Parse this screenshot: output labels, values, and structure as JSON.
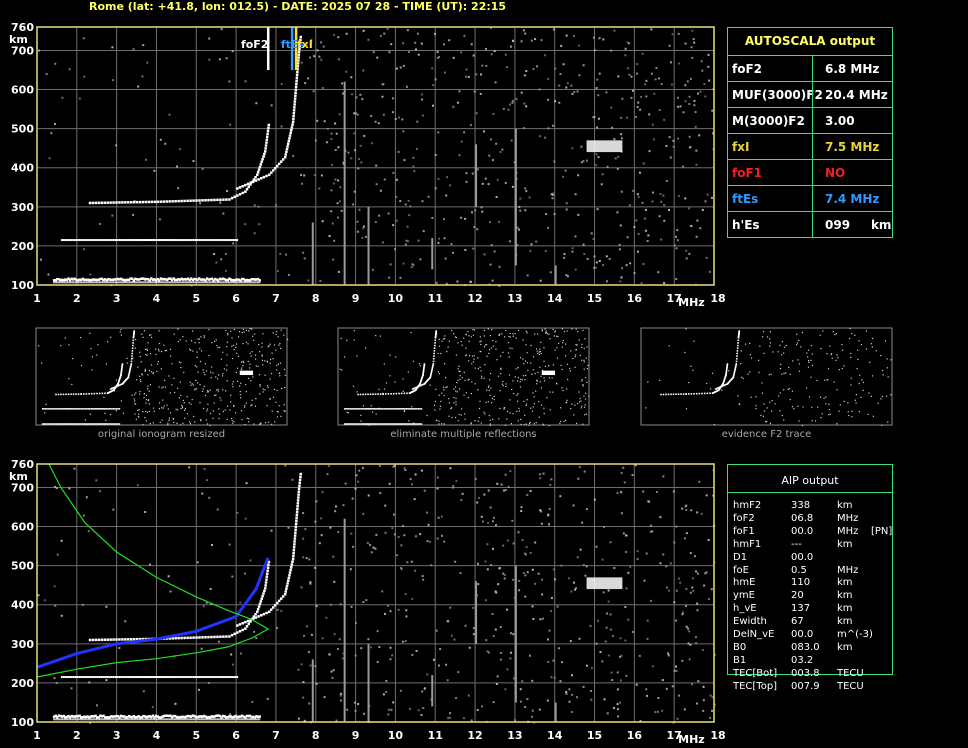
{
  "header": "Rome (lat: +41.8, lon: 012.5) - DATE: 2025 07 28 - TIME (UT): 22:15",
  "chart_data": [
    {
      "type": "scatter",
      "name_panel": "main",
      "xlim": [
        1,
        18
      ],
      "ylim": [
        100,
        760
      ],
      "xticks": [
        "1",
        "2",
        "3",
        "4",
        "5",
        "6",
        "7",
        "8",
        "9",
        "10",
        "11",
        "12",
        "13",
        "14",
        "15",
        "16",
        "17",
        "18"
      ],
      "yticks": [
        "100",
        "200",
        "300",
        "400",
        "500",
        "600",
        "700",
        "760"
      ],
      "xunit": "MHz",
      "yunit": "km",
      "markers": [
        {
          "label": "foF2",
          "freq": 6.8,
          "color": "#ffffff"
        },
        {
          "label": "ftEs",
          "freq": 7.4,
          "color": "#3399ff"
        },
        {
          "label": "fxI",
          "freq": 7.5,
          "color": "#ffdd33"
        }
      ],
      "traces": {
        "Es": {
          "h": 112,
          "f_from": 1.4,
          "f_to": 6.6
        },
        "Es2": {
          "h": 215,
          "f_from": 1.6,
          "f_to": 6.0
        },
        "F_o": [
          [
            2.3,
            313
          ],
          [
            4.0,
            316
          ],
          [
            5.8,
            322
          ],
          [
            6.2,
            342
          ],
          [
            6.5,
            385
          ],
          [
            6.7,
            445
          ],
          [
            6.8,
            520
          ]
        ],
        "F_x": [
          [
            6.0,
            350
          ],
          [
            6.8,
            385
          ],
          [
            7.2,
            430
          ],
          [
            7.4,
            520
          ],
          [
            7.55,
            700
          ],
          [
            7.6,
            745
          ]
        ]
      }
    },
    {
      "type": "scatter",
      "name_panel": "aip",
      "xlim": [
        1,
        18
      ],
      "ylim": [
        100,
        760
      ],
      "xticks": [
        "1",
        "2",
        "3",
        "4",
        "5",
        "6",
        "7",
        "8",
        "9",
        "10",
        "11",
        "12",
        "13",
        "14",
        "15",
        "16",
        "17",
        "18"
      ],
      "yticks": [
        "100",
        "200",
        "300",
        "400",
        "500",
        "600",
        "700",
        "760"
      ],
      "xunit": "MHz",
      "yunit": "km",
      "profile": [
        [
          1.0,
          215
        ],
        [
          2.0,
          235
        ],
        [
          3.0,
          252
        ],
        [
          4.0,
          262
        ],
        [
          5.0,
          277
        ],
        [
          5.8,
          292
        ],
        [
          6.4,
          315
        ],
        [
          6.8,
          338
        ],
        [
          6.4,
          362
        ],
        [
          5.8,
          385
        ],
        [
          5.0,
          420
        ],
        [
          4.0,
          470
        ],
        [
          3.0,
          535
        ],
        [
          2.2,
          610
        ],
        [
          1.6,
          700
        ],
        [
          1.3,
          760
        ]
      ],
      "model_trace": [
        [
          1.0,
          240
        ],
        [
          2.0,
          275
        ],
        [
          3.0,
          300
        ],
        [
          4.0,
          312
        ],
        [
          5.0,
          332
        ],
        [
          6.0,
          370
        ],
        [
          6.5,
          440
        ],
        [
          6.8,
          520
        ]
      ]
    }
  ],
  "autoscala": {
    "title": "AUTOSCALA output",
    "rows": [
      {
        "label": "foF2",
        "value": "6.8 MHz",
        "color": "#ffffff"
      },
      {
        "label": "MUF(3000)F2",
        "value": "20.4 MHz",
        "color": "#ffffff"
      },
      {
        "label": "M(3000)F2",
        "value": "3.00",
        "color": "#ffffff"
      },
      {
        "label": "fxI",
        "value": "7.5 MHz",
        "color": "#e6d23c"
      },
      {
        "label": "foF1",
        "value": "NO",
        "color": "#ee2222"
      },
      {
        "label": "ftEs",
        "value": "7.4 MHz",
        "color": "#3399ff"
      },
      {
        "label": "h'Es",
        "value": "099     km",
        "color": "#ffffff"
      }
    ]
  },
  "thumbnails": [
    {
      "caption": "original ionogram resized"
    },
    {
      "caption": "eliminate multiple reflections"
    },
    {
      "caption": "evidence F2 trace"
    }
  ],
  "aip": {
    "title": "AIP output",
    "rows": [
      [
        "hmF2",
        "338",
        "km",
        ""
      ],
      [
        "foF2",
        "06.8",
        "MHz",
        ""
      ],
      [
        "foF1",
        "00.0",
        "MHz",
        "[PN]"
      ],
      [
        "hmF1",
        "---",
        "km",
        ""
      ],
      [
        "D1",
        "00.0",
        "",
        ""
      ],
      [
        "foE",
        "0.5",
        "MHz",
        ""
      ],
      [
        "hmE",
        "110",
        "km",
        ""
      ],
      [
        "ymE",
        "20",
        "km",
        ""
      ],
      [
        "h_vE",
        "137",
        "km",
        ""
      ],
      [
        "Ewidth",
        "67",
        "km",
        ""
      ],
      [
        "DelN_vE",
        "00.0",
        "m^(-3)",
        ""
      ],
      [
        "B0",
        "083.0",
        "km",
        ""
      ],
      [
        "B1",
        "03.2",
        "",
        ""
      ],
      [
        "TEC[Bot]",
        "003.8",
        "TECU",
        ""
      ],
      [
        "TEC[Top]",
        "007.9",
        "TECU",
        ""
      ]
    ]
  }
}
